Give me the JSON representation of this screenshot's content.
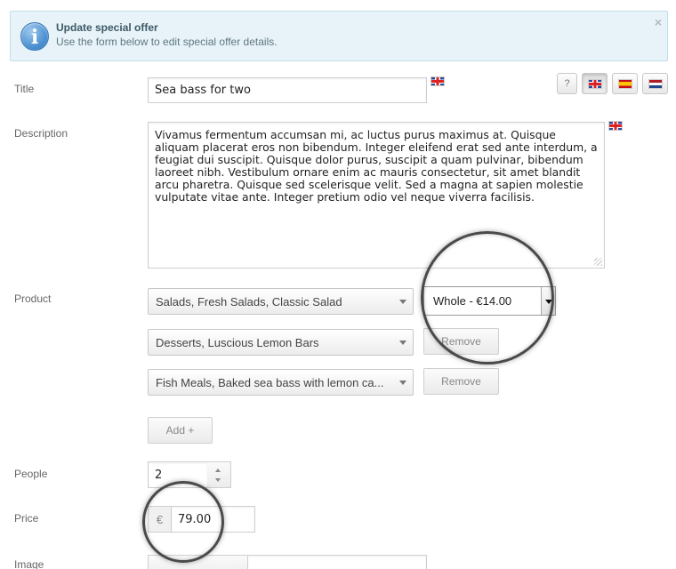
{
  "banner": {
    "title": "Update special offer",
    "subtitle": "Use the form below to edit special offer details.",
    "icon": "info-icon",
    "close_glyph": "×"
  },
  "form": {
    "title_label": "Title",
    "title_value": "Sea bass for two",
    "description_label": "Description",
    "description_value": "Vivamus fermentum accumsan mi, ac luctus purus maximus at. Quisque aliquam placerat eros non bibendum. Integer eleifend erat sed ante interdum, a feugiat dui suscipit. Quisque dolor purus, suscipit a quam pulvinar, bibendum laoreet nibh. Vestibulum ornare enim ac mauris consectetur, sit amet blandit arcu pharetra. Quisque sed scelerisque velit. Sed a magna at sapien molestie vulputate vitae ante. Integer pretium odio vel neque viverra facilisis.",
    "product_label": "Product",
    "products": [
      {
        "name": "Salads, Fresh Salads, Classic Salad",
        "variant": "Whole - €14.00"
      },
      {
        "name": "Desserts, Luscious Lemon Bars",
        "action": "Remove"
      },
      {
        "name": "Fish Meals, Baked sea bass with lemon ca...",
        "action": "Remove"
      }
    ],
    "add_label": "Add +",
    "people_label": "People",
    "people_value": "2",
    "price_label": "Price",
    "currency": "€",
    "price_value": "79.00",
    "image_label": "Image"
  },
  "languages": {
    "help_label": "?",
    "items": [
      {
        "code": "en",
        "icon": "uk-flag-icon",
        "active": true
      },
      {
        "code": "es",
        "icon": "spain-flag-icon",
        "active": false
      },
      {
        "code": "nl",
        "icon": "netherlands-flag-icon",
        "active": false
      }
    ]
  },
  "colors": {
    "banner_bg": "#e7f3f8",
    "banner_border": "#bfe0ec",
    "info_blue": "#4a8fd0"
  }
}
